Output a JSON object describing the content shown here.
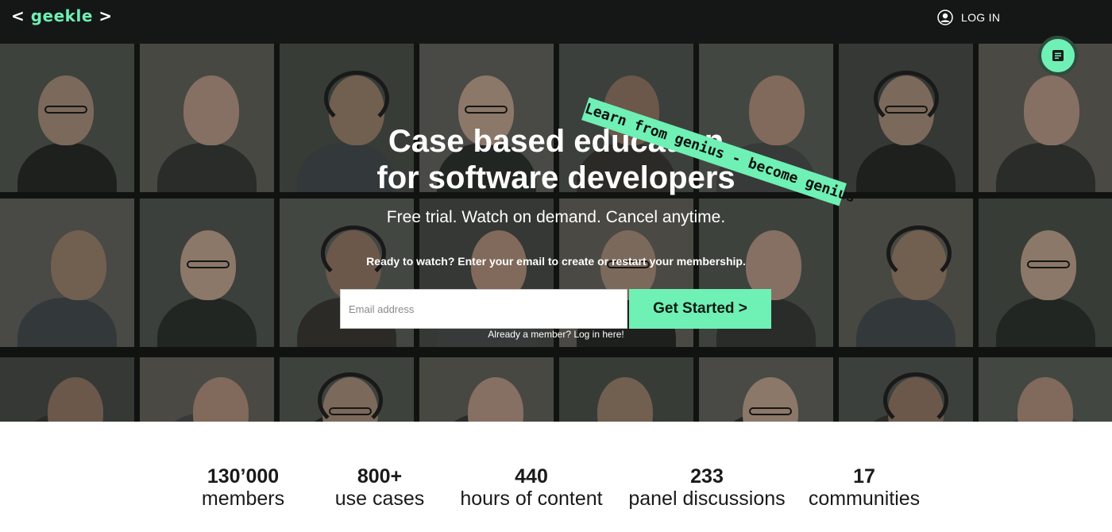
{
  "header": {
    "logo_left_bracket": "<",
    "logo_word": "geekle",
    "logo_right_bracket": ">",
    "login_label": "LOG IN",
    "login_icon": "user-circle-icon"
  },
  "hero": {
    "ribbon_text": "Learn from genius - become genius",
    "headline_line1": "Case based education",
    "headline_line2": "for software developers",
    "subline": "Free trial. Watch on demand. Cancel anytime.",
    "prompt": "Ready to watch? Enter your email to create or restart your membership.",
    "email_placeholder": "Email address",
    "cta_label": "Get Started >",
    "member_link": "Already a member? Log in here!",
    "fab_icon": "document-icon"
  },
  "stats": [
    {
      "value": "130’000",
      "label": "members"
    },
    {
      "value": "800+",
      "label": "use cases"
    },
    {
      "value": "440",
      "label": "hours of content"
    },
    {
      "value": "233",
      "label": "panel discussions"
    },
    {
      "value": "17",
      "label": "communities"
    }
  ],
  "colors": {
    "accent": "#6ff0b4",
    "topbar": "#151716",
    "text_dark": "#1a1a1a"
  }
}
